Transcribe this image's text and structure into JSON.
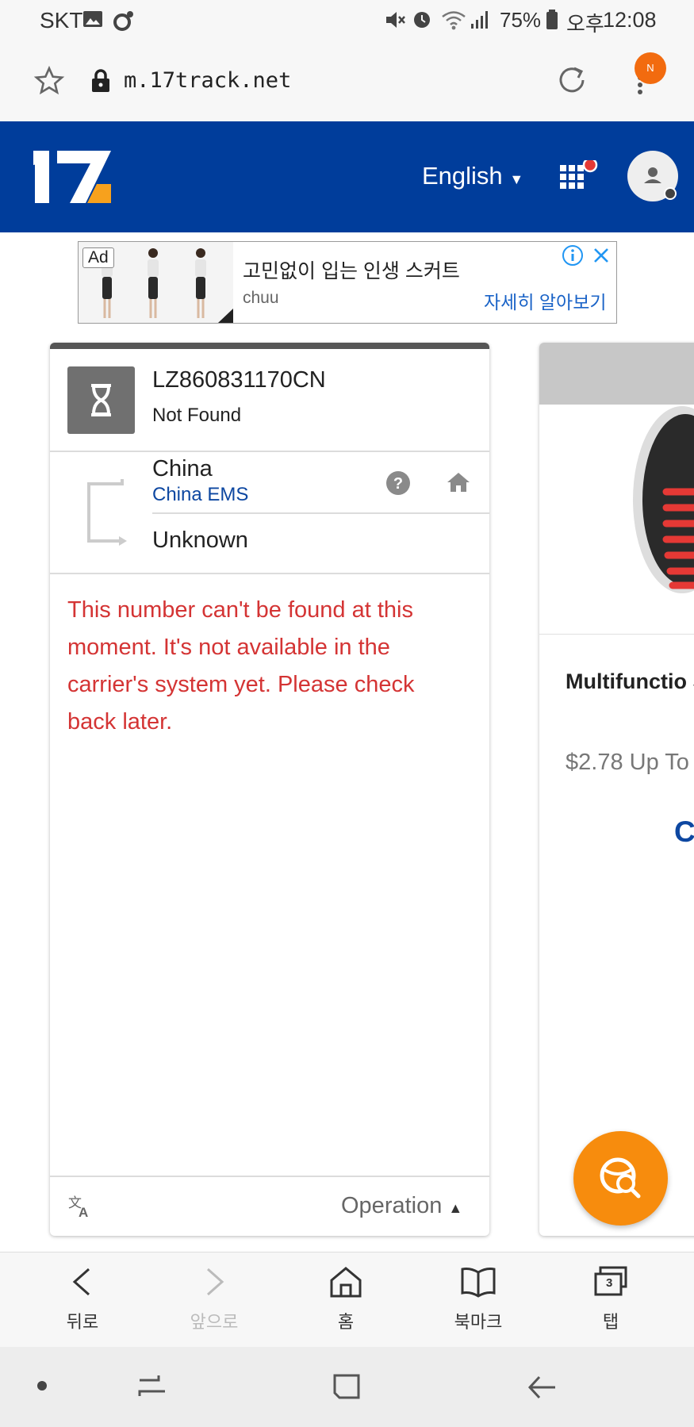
{
  "status_bar": {
    "carrier": "SKT",
    "battery": "75%",
    "period": "오후",
    "time": "12:08"
  },
  "browser": {
    "url": "m.17track.net",
    "notification_badge": "N"
  },
  "header": {
    "logo_text": "17",
    "language": "English",
    "brand_color": "#003d9b",
    "accent_color": "#f26b0f"
  },
  "ad": {
    "badge": "Ad",
    "title": "고민없이 입는 인생 스커트",
    "advertiser": "chuu",
    "cta": "자세히 알아보기"
  },
  "tracking": {
    "number": "LZ860831170CN",
    "status": "Not Found",
    "origin_country": "China",
    "carrier": "China EMS",
    "destination": "Unknown",
    "message": "This number can't be found at this moment. It's not available in the carrier's system yet. Please check back later.",
    "operation_label": "Operation",
    "error_color": "#d43434"
  },
  "product_card": {
    "title": "Multifunctio Shoelaces S",
    "price": "$2.78 Up To",
    "cta": "C"
  },
  "bottom_nav": {
    "back": "뒤로",
    "forward": "앞으로",
    "home": "홈",
    "bookmark": "북마크",
    "tabs": "탭",
    "tab_count": "3"
  }
}
